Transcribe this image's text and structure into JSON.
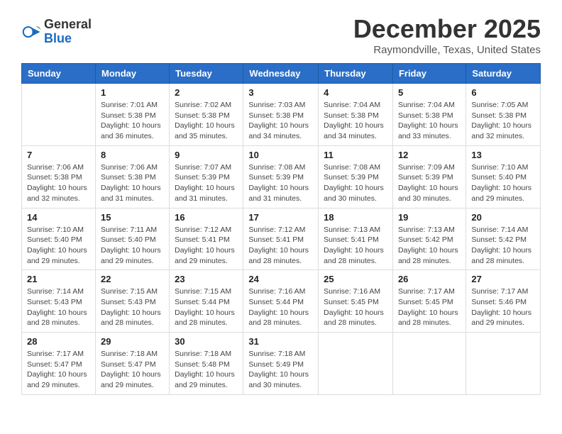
{
  "header": {
    "logo_general": "General",
    "logo_blue": "Blue",
    "month": "December 2025",
    "location": "Raymondville, Texas, United States"
  },
  "weekdays": [
    "Sunday",
    "Monday",
    "Tuesday",
    "Wednesday",
    "Thursday",
    "Friday",
    "Saturday"
  ],
  "weeks": [
    [
      {
        "day": "",
        "info": ""
      },
      {
        "day": "1",
        "info": "Sunrise: 7:01 AM\nSunset: 5:38 PM\nDaylight: 10 hours\nand 36 minutes."
      },
      {
        "day": "2",
        "info": "Sunrise: 7:02 AM\nSunset: 5:38 PM\nDaylight: 10 hours\nand 35 minutes."
      },
      {
        "day": "3",
        "info": "Sunrise: 7:03 AM\nSunset: 5:38 PM\nDaylight: 10 hours\nand 34 minutes."
      },
      {
        "day": "4",
        "info": "Sunrise: 7:04 AM\nSunset: 5:38 PM\nDaylight: 10 hours\nand 34 minutes."
      },
      {
        "day": "5",
        "info": "Sunrise: 7:04 AM\nSunset: 5:38 PM\nDaylight: 10 hours\nand 33 minutes."
      },
      {
        "day": "6",
        "info": "Sunrise: 7:05 AM\nSunset: 5:38 PM\nDaylight: 10 hours\nand 32 minutes."
      }
    ],
    [
      {
        "day": "7",
        "info": "Sunrise: 7:06 AM\nSunset: 5:38 PM\nDaylight: 10 hours\nand 32 minutes."
      },
      {
        "day": "8",
        "info": "Sunrise: 7:06 AM\nSunset: 5:38 PM\nDaylight: 10 hours\nand 31 minutes."
      },
      {
        "day": "9",
        "info": "Sunrise: 7:07 AM\nSunset: 5:39 PM\nDaylight: 10 hours\nand 31 minutes."
      },
      {
        "day": "10",
        "info": "Sunrise: 7:08 AM\nSunset: 5:39 PM\nDaylight: 10 hours\nand 31 minutes."
      },
      {
        "day": "11",
        "info": "Sunrise: 7:08 AM\nSunset: 5:39 PM\nDaylight: 10 hours\nand 30 minutes."
      },
      {
        "day": "12",
        "info": "Sunrise: 7:09 AM\nSunset: 5:39 PM\nDaylight: 10 hours\nand 30 minutes."
      },
      {
        "day": "13",
        "info": "Sunrise: 7:10 AM\nSunset: 5:40 PM\nDaylight: 10 hours\nand 29 minutes."
      }
    ],
    [
      {
        "day": "14",
        "info": "Sunrise: 7:10 AM\nSunset: 5:40 PM\nDaylight: 10 hours\nand 29 minutes."
      },
      {
        "day": "15",
        "info": "Sunrise: 7:11 AM\nSunset: 5:40 PM\nDaylight: 10 hours\nand 29 minutes."
      },
      {
        "day": "16",
        "info": "Sunrise: 7:12 AM\nSunset: 5:41 PM\nDaylight: 10 hours\nand 29 minutes."
      },
      {
        "day": "17",
        "info": "Sunrise: 7:12 AM\nSunset: 5:41 PM\nDaylight: 10 hours\nand 28 minutes."
      },
      {
        "day": "18",
        "info": "Sunrise: 7:13 AM\nSunset: 5:41 PM\nDaylight: 10 hours\nand 28 minutes."
      },
      {
        "day": "19",
        "info": "Sunrise: 7:13 AM\nSunset: 5:42 PM\nDaylight: 10 hours\nand 28 minutes."
      },
      {
        "day": "20",
        "info": "Sunrise: 7:14 AM\nSunset: 5:42 PM\nDaylight: 10 hours\nand 28 minutes."
      }
    ],
    [
      {
        "day": "21",
        "info": "Sunrise: 7:14 AM\nSunset: 5:43 PM\nDaylight: 10 hours\nand 28 minutes."
      },
      {
        "day": "22",
        "info": "Sunrise: 7:15 AM\nSunset: 5:43 PM\nDaylight: 10 hours\nand 28 minutes."
      },
      {
        "day": "23",
        "info": "Sunrise: 7:15 AM\nSunset: 5:44 PM\nDaylight: 10 hours\nand 28 minutes."
      },
      {
        "day": "24",
        "info": "Sunrise: 7:16 AM\nSunset: 5:44 PM\nDaylight: 10 hours\nand 28 minutes."
      },
      {
        "day": "25",
        "info": "Sunrise: 7:16 AM\nSunset: 5:45 PM\nDaylight: 10 hours\nand 28 minutes."
      },
      {
        "day": "26",
        "info": "Sunrise: 7:17 AM\nSunset: 5:45 PM\nDaylight: 10 hours\nand 28 minutes."
      },
      {
        "day": "27",
        "info": "Sunrise: 7:17 AM\nSunset: 5:46 PM\nDaylight: 10 hours\nand 29 minutes."
      }
    ],
    [
      {
        "day": "28",
        "info": "Sunrise: 7:17 AM\nSunset: 5:47 PM\nDaylight: 10 hours\nand 29 minutes."
      },
      {
        "day": "29",
        "info": "Sunrise: 7:18 AM\nSunset: 5:47 PM\nDaylight: 10 hours\nand 29 minutes."
      },
      {
        "day": "30",
        "info": "Sunrise: 7:18 AM\nSunset: 5:48 PM\nDaylight: 10 hours\nand 29 minutes."
      },
      {
        "day": "31",
        "info": "Sunrise: 7:18 AM\nSunset: 5:49 PM\nDaylight: 10 hours\nand 30 minutes."
      },
      {
        "day": "",
        "info": ""
      },
      {
        "day": "",
        "info": ""
      },
      {
        "day": "",
        "info": ""
      }
    ]
  ]
}
